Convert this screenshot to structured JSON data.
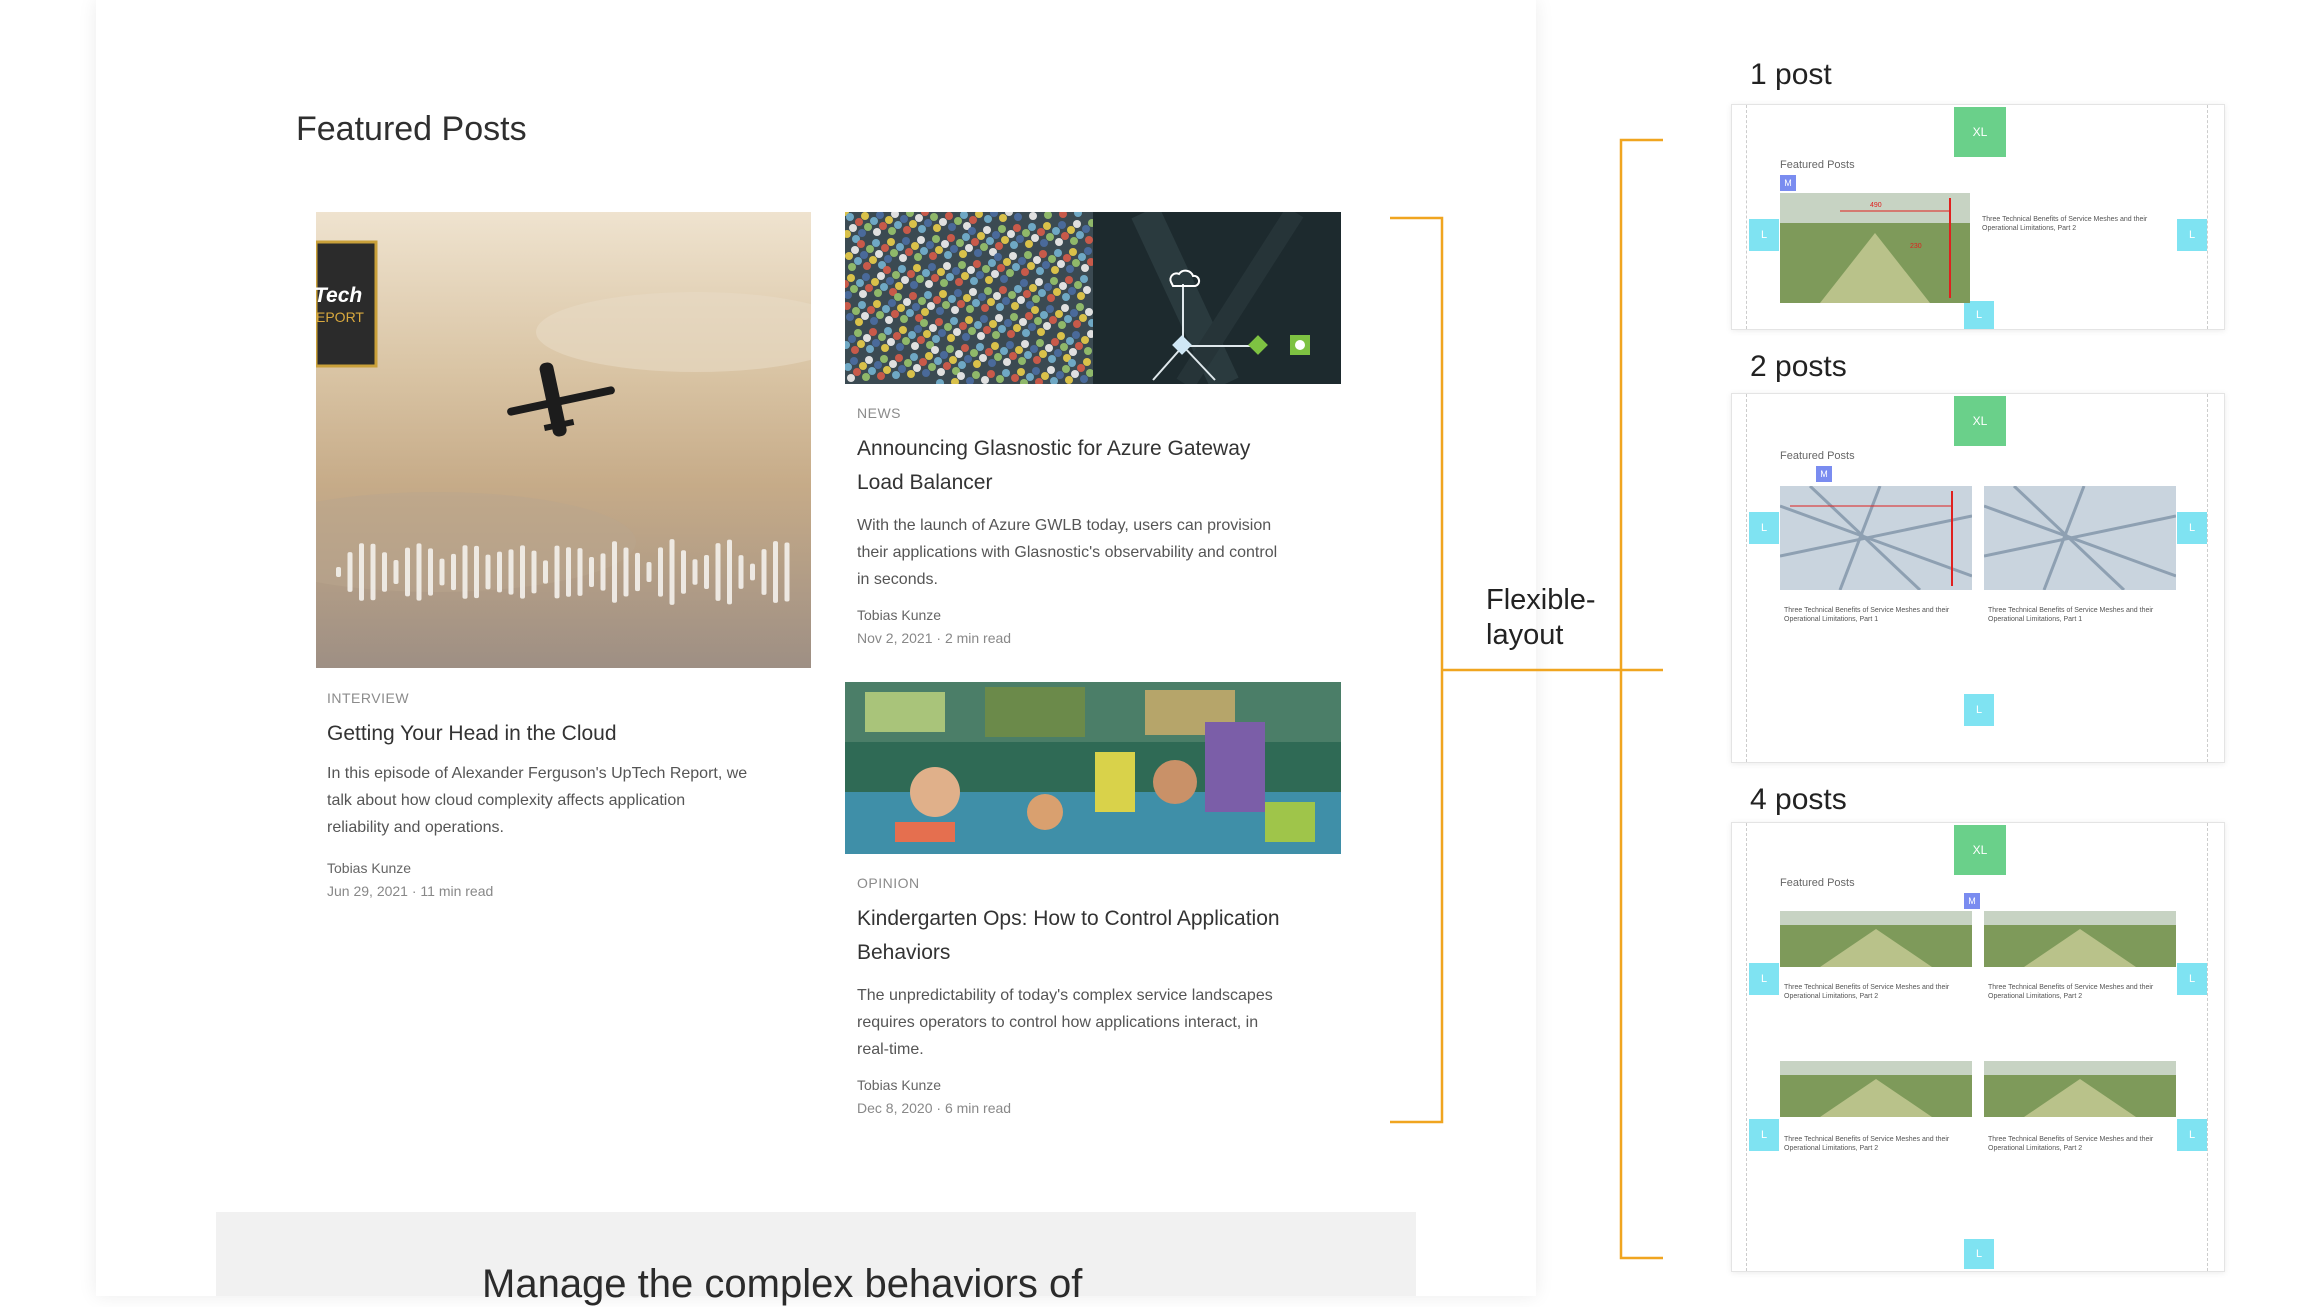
{
  "section_title": "Featured Posts",
  "posts": [
    {
      "category": "INTERVIEW",
      "title": "Getting Your Head in the Cloud",
      "excerpt_lines": [
        "In this episode of Alexander Ferguson's UpTech Report, we",
        "talk about how cloud complexity affects application",
        "reliability and operations."
      ],
      "author": "Tobias Kunze",
      "meta": "Jun 29, 2021 · 11 min read",
      "image_text": [
        "Tech",
        "EPORT"
      ]
    },
    {
      "category": "NEWS",
      "title_lines": [
        "Announcing Glasnostic for Azure Gateway",
        "Load Balancer"
      ],
      "excerpt_lines": [
        "With the launch of Azure GWLB today, users can provision",
        "their applications with Glasnostic's observability and control",
        "in seconds."
      ],
      "author": "Tobias Kunze",
      "meta": "Nov 2, 2021 · 2 min read"
    },
    {
      "category": "OPINION",
      "title_lines": [
        "Kindergarten Ops: How to Control Application",
        "Behaviors"
      ],
      "excerpt_lines": [
        "The unpredictability of today's complex service landscapes",
        "requires operators to control how applications interact, in",
        "real-time."
      ],
      "author": "Tobias Kunze",
      "meta": "Dec 8, 2020 · 6 min read"
    }
  ],
  "bottom_heading": "Manage the complex behaviors of",
  "annotation": {
    "label_lines": [
      "Flexible-",
      "layout"
    ],
    "colors": {
      "bracket": "#f0a520"
    }
  },
  "variants": [
    {
      "title": "1 post"
    },
    {
      "title": "2 posts"
    },
    {
      "title": "4 posts"
    }
  ],
  "mini": {
    "featured": "Featured Posts",
    "xl": "XL",
    "l": "L",
    "m": "M",
    "dim_a": "490",
    "dim_b": "230",
    "post_title_1": "Three Technical Benefits of Service Meshes and their",
    "post_title_2a": "Operational Limitations, Part 2",
    "post_title_2b": "Operational Limitations, Part 1"
  }
}
